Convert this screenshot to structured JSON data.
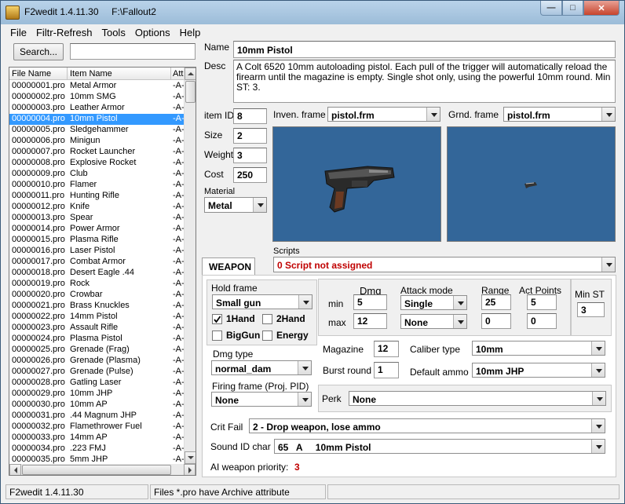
{
  "window": {
    "title": "F2wedit 1.4.11.30     F:\\Fallout2",
    "min_label": "—",
    "max_label": "□",
    "close_label": "✕"
  },
  "menu": [
    "File",
    "Filtr-Refresh",
    "Tools",
    "Options",
    "Help"
  ],
  "search": {
    "button_label": "Search...",
    "value": ""
  },
  "list": {
    "headers": [
      "File Name",
      "Item Name",
      "Att"
    ],
    "selected_index": 3,
    "rows": [
      [
        "00000001.pro",
        "Metal Armor",
        "-A-"
      ],
      [
        "00000002.pro",
        "10mm SMG",
        "-A-"
      ],
      [
        "00000003.pro",
        "Leather Armor",
        "-A-"
      ],
      [
        "00000004.pro",
        "10mm Pistol",
        "-A-"
      ],
      [
        "00000005.pro",
        "Sledgehammer",
        "-A-"
      ],
      [
        "00000006.pro",
        "Minigun",
        "-A-"
      ],
      [
        "00000007.pro",
        "Rocket Launcher",
        "-A-"
      ],
      [
        "00000008.pro",
        "Explosive Rocket",
        "-A-"
      ],
      [
        "00000009.pro",
        "Club",
        "-A-"
      ],
      [
        "00000010.pro",
        "Flamer",
        "-A-"
      ],
      [
        "00000011.pro",
        "Hunting Rifle",
        "-A-"
      ],
      [
        "00000012.pro",
        "Knife",
        "-A-"
      ],
      [
        "00000013.pro",
        "Spear",
        "-A-"
      ],
      [
        "00000014.pro",
        "Power Armor",
        "-A-"
      ],
      [
        "00000015.pro",
        "Plasma Rifle",
        "-A-"
      ],
      [
        "00000016.pro",
        "Laser Pistol",
        "-A-"
      ],
      [
        "00000017.pro",
        "Combat Armor",
        "-A-"
      ],
      [
        "00000018.pro",
        "Desert Eagle .44",
        "-A-"
      ],
      [
        "00000019.pro",
        "Rock",
        "-A-"
      ],
      [
        "00000020.pro",
        "Crowbar",
        "-A-"
      ],
      [
        "00000021.pro",
        "Brass Knuckles",
        "-A-"
      ],
      [
        "00000022.pro",
        "14mm Pistol",
        "-A-"
      ],
      [
        "00000023.pro",
        "Assault Rifle",
        "-A-"
      ],
      [
        "00000024.pro",
        "Plasma Pistol",
        "-A-"
      ],
      [
        "00000025.pro",
        "Grenade (Frag)",
        "-A-"
      ],
      [
        "00000026.pro",
        "Grenade (Plasma)",
        "-A-"
      ],
      [
        "00000027.pro",
        "Grenade (Pulse)",
        "-A-"
      ],
      [
        "00000028.pro",
        "Gatling Laser",
        "-A-"
      ],
      [
        "00000029.pro",
        "10mm JHP",
        "-A-"
      ],
      [
        "00000030.pro",
        "10mm AP",
        "-A-"
      ],
      [
        "00000031.pro",
        ".44 Magnum JHP",
        "-A-"
      ],
      [
        "00000032.pro",
        "Flamethrower Fuel",
        "-A-"
      ],
      [
        "00000033.pro",
        "14mm AP",
        "-A-"
      ],
      [
        "00000034.pro",
        ".223 FMJ",
        "-A-"
      ],
      [
        "00000035.pro",
        "5mm JHP",
        "-A-"
      ]
    ]
  },
  "item": {
    "name_label": "Name",
    "name": "10mm Pistol",
    "desc_label": "Desc",
    "desc": "A Colt 6520 10mm autoloading pistol. Each pull of the trigger will automatically reload the firearm until the magazine is empty. Single shot only, using the powerful 10mm round. Min ST: 3.",
    "id_label": "item ID",
    "id": "8",
    "size_label": "Size",
    "size": "2",
    "weight_label": "Weight",
    "weight": "3",
    "cost_label": "Cost",
    "cost": "250",
    "material_label": "Material",
    "material": "Metal",
    "inven_label": "Inven. frame",
    "inven_frame": "pistol.frm",
    "grnd_label": "Grnd. frame",
    "grnd_frame": "pistol.frm",
    "scripts_label": "Scripts",
    "script": "0 Script not assigned"
  },
  "weapon": {
    "tab_label": "WEAPON",
    "hold_label": "Hold frame",
    "hold": "Small gun",
    "hand1_label": "1Hand",
    "hand2_label": "2Hand",
    "biggun_label": "BigGun",
    "energy_label": "Energy",
    "dmg_type_label": "Dmg type",
    "dmg_type": "normal_dam",
    "firing_label": "Firing frame (Proj. PID)",
    "firing": "None",
    "dmg_label": "Dmg",
    "min_label": "min",
    "max_label": "max",
    "dmg_min": "5",
    "dmg_max": "12",
    "attack_label": "Attack mode",
    "attack1": "Single",
    "attack2": "None",
    "range_label": "Range",
    "range1": "25",
    "range2": "0",
    "ap_label": "Act Points",
    "ap1": "5",
    "ap2": "0",
    "minst_label": "Min ST",
    "minst": "3",
    "magazine_label": "Magazine",
    "magazine": "12",
    "burst_label": "Burst round",
    "burst": "1",
    "caliber_label": "Caliber type",
    "caliber": "10mm",
    "ammo_label": "Default ammo",
    "ammo": "10mm JHP",
    "perk_label": "Perk",
    "perk": "None",
    "crit_label": "Crit Fail",
    "crit": "2 - Drop weapon, lose ammo",
    "sound_label": "Sound ID char",
    "sound": "65   A     10mm Pistol",
    "ai_label": "AI weapon priority:",
    "ai": "3"
  },
  "status": {
    "version": "F2wedit 1.4.11.30",
    "message": "Files *.pro have Archive attribute"
  }
}
